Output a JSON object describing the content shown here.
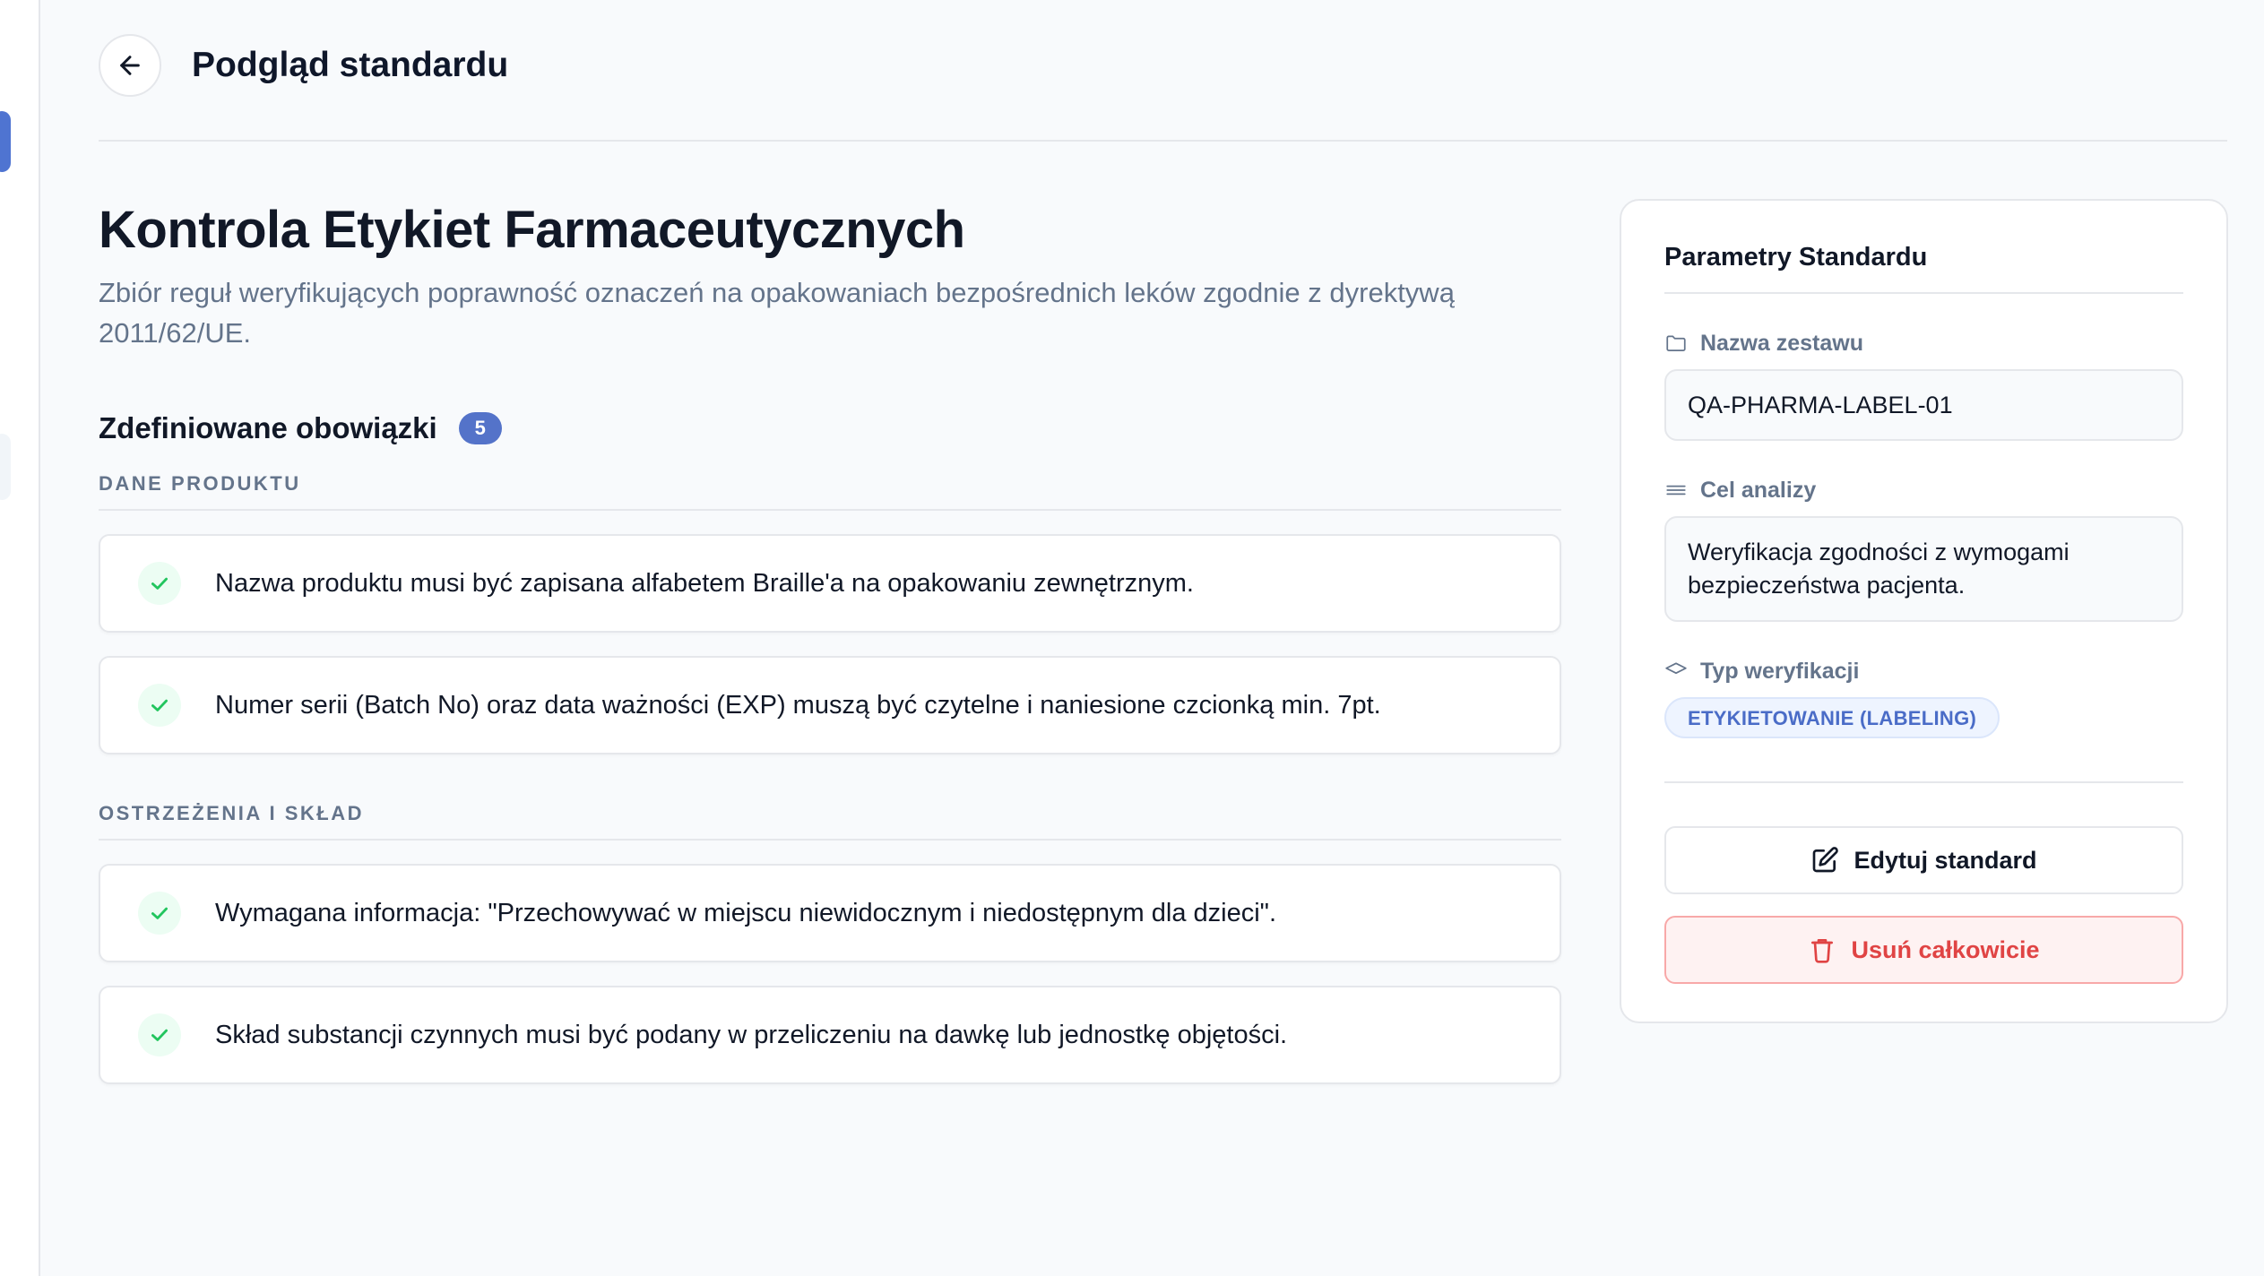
{
  "header": {
    "title": "Podgląd standardu"
  },
  "standard": {
    "title": "Kontrola Etykiet Farmaceutycznych",
    "description": "Zbiór reguł weryfikujących poprawność oznaczeń na opakowaniach bezpośrednich leków zgodnie z dyrektywą 2011/62/UE."
  },
  "obligations": {
    "label": "Zdefiniowane obowiązki",
    "count": "5",
    "groups": [
      {
        "title": "DANE PRODUKTU",
        "items": [
          "Nazwa produktu musi być zapisana alfabetem Braille'a na opakowaniu zewnętrznym.",
          "Numer serii (Batch No) oraz data ważności (EXP) muszą być czytelne i naniesione czcionką min. 7pt."
        ]
      },
      {
        "title": "OSTRZEŻENIA I SKŁAD",
        "items": [
          "Wymagana informacja: \"Przechowywać w miejscu niewidocznym i niedostępnym dla dzieci\".",
          "Skład substancji czynnych musi być podany w przeliczeniu na dawkę lub jednostkę objętości."
        ]
      }
    ]
  },
  "panel": {
    "title": "Parametry Standardu",
    "set_name_label": "Nazwa zestawu",
    "set_name_value": "QA-PHARMA-LABEL-01",
    "goal_label": "Cel analizy",
    "goal_value": "Weryfikacja zgodności z wymogami bezpieczeństwa pacjenta.",
    "type_label": "Typ weryfikacji",
    "type_value": "ETYKIETOWANIE (LABELING)",
    "edit_label": "Edytuj standard",
    "delete_label": "Usuń całkowicie"
  },
  "colors": {
    "accent": "#5473c9",
    "success": "#22c55e",
    "danger": "#e04444",
    "background": "#f8fafc"
  },
  "icons": {
    "back": "arrow-left-icon",
    "check": "check-icon",
    "set_name": "folder-icon",
    "goal": "lines-icon",
    "type": "tag-icon",
    "edit": "pencil-square-icon",
    "delete": "trash-icon"
  }
}
